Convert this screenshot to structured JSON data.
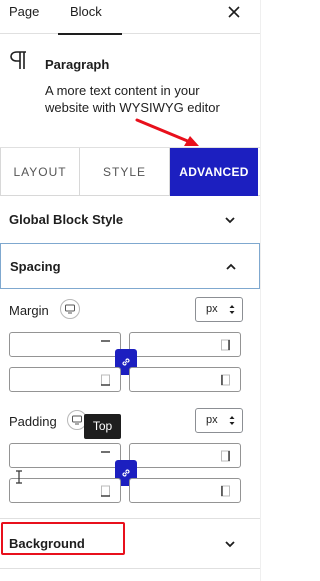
{
  "top_tabs": {
    "page": "Page",
    "block": "Block",
    "active": "Block"
  },
  "block_card": {
    "title": "Paragraph",
    "description": "A more text content in your website with WYSIWYG editor",
    "icon": "paragraph-icon"
  },
  "style_tabs": {
    "layout": "LAYOUT",
    "style": "STYLE",
    "advanced": "ADVANCED",
    "active": "ADVANCED"
  },
  "panels": {
    "global_block_style": "Global Block Style",
    "spacing": "Spacing",
    "background": "Background"
  },
  "spacing": {
    "margin": {
      "label": "Margin",
      "unit": "px",
      "top": "",
      "right": "",
      "bottom": "",
      "left": ""
    },
    "padding": {
      "label": "Padding",
      "unit": "px",
      "top": "",
      "right": "",
      "bottom": "",
      "left": ""
    }
  },
  "tooltip": "Top",
  "colors": {
    "accent": "#1c1fc0",
    "annotation": "#e8101c",
    "focus_border": "#7fa8cf"
  }
}
